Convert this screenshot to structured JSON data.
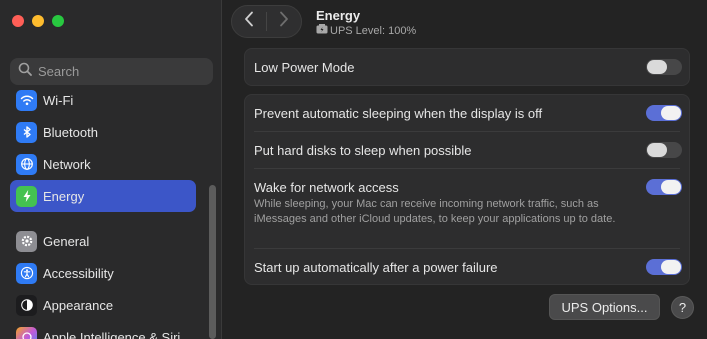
{
  "window": {
    "title": "Energy",
    "subtitle": "UPS Level: 100%"
  },
  "search": {
    "placeholder": "Search"
  },
  "sidebar": {
    "items": [
      {
        "label": "Wi-Fi",
        "icon": "wifi-icon",
        "color": "#2f7bf5"
      },
      {
        "label": "Bluetooth",
        "icon": "bluetooth-icon",
        "color": "#2f7bf5"
      },
      {
        "label": "Network",
        "icon": "globe-icon",
        "color": "#2f7bf5"
      },
      {
        "label": "Energy",
        "icon": "bolt-icon",
        "color": "#44c251",
        "active": true
      },
      {
        "label": "General",
        "icon": "gear-icon",
        "color": "#8e8e93"
      },
      {
        "label": "Accessibility",
        "icon": "accessibility-icon",
        "color": "#2f7bf5"
      },
      {
        "label": "Appearance",
        "icon": "appearance-icon",
        "color": "#1c1c1e"
      },
      {
        "label": "Apple Intelligence & Siri",
        "icon": "siri-icon",
        "color": "#c25ad8"
      }
    ]
  },
  "settings": {
    "low_power": {
      "label": "Low Power Mode",
      "on": false
    },
    "prevent_sleep": {
      "label": "Prevent automatic sleeping when the display is off",
      "on": true
    },
    "hard_disks": {
      "label": "Put hard disks to sleep when possible",
      "on": false
    },
    "wake_network": {
      "label": "Wake for network access",
      "description": "While sleeping, your Mac can receive incoming network traffic, such as iMessages and other iCloud updates, to keep your applications up to date.",
      "on": true
    },
    "startup_power": {
      "label": "Start up automatically after a power failure",
      "on": true
    }
  },
  "buttons": {
    "ups_options": "UPS Options...",
    "help": "?"
  },
  "colors": {
    "accent": "#3c56c8",
    "toggle_on": "#5b6fd6"
  }
}
